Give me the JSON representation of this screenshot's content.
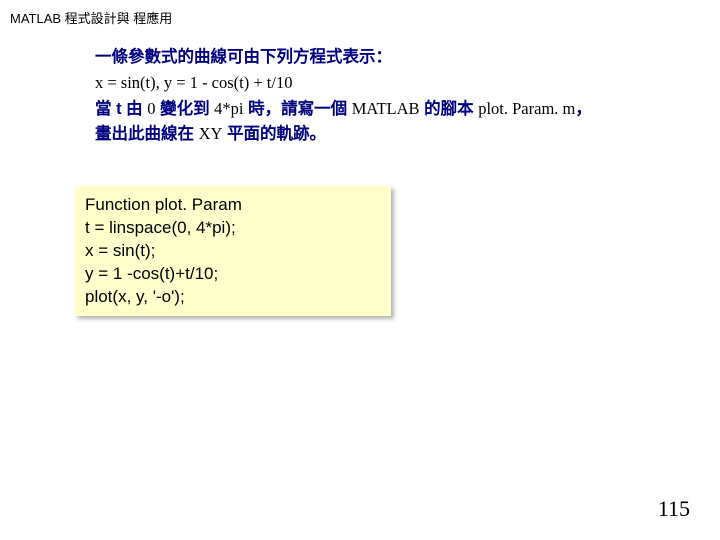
{
  "page_title": "MATLAB 程式設計與 程應用",
  "prompt": {
    "line1": "一條參數式的曲線可由下列方程式表示：",
    "line2": "x = sin(t), y = 1 - cos(t) + t/10",
    "line3_p1": "當 t 由 ",
    "line3_p2": "0",
    "line3_p3": " 變化到  ",
    "line3_p4": "4*pi",
    "line3_p5": " 時，請寫一個 ",
    "line3_p6": "MATLAB",
    "line3_p7": " 的腳本 ",
    "line3_p8": "plot. Param. m",
    "line3_p9": "，",
    "line4_p1": "畫出此曲線在   ",
    "line4_p2": "XY",
    "line4_p3": " 平面的軌跡。"
  },
  "code": {
    "l1": "Function plot. Param",
    "l2": "t = linspace(0, 4*pi);",
    "l3": "x = sin(t);",
    "l4": "y = 1 -cos(t)+t/10;",
    "l5": "plot(x, y, '-o');"
  },
  "page_number": "115"
}
